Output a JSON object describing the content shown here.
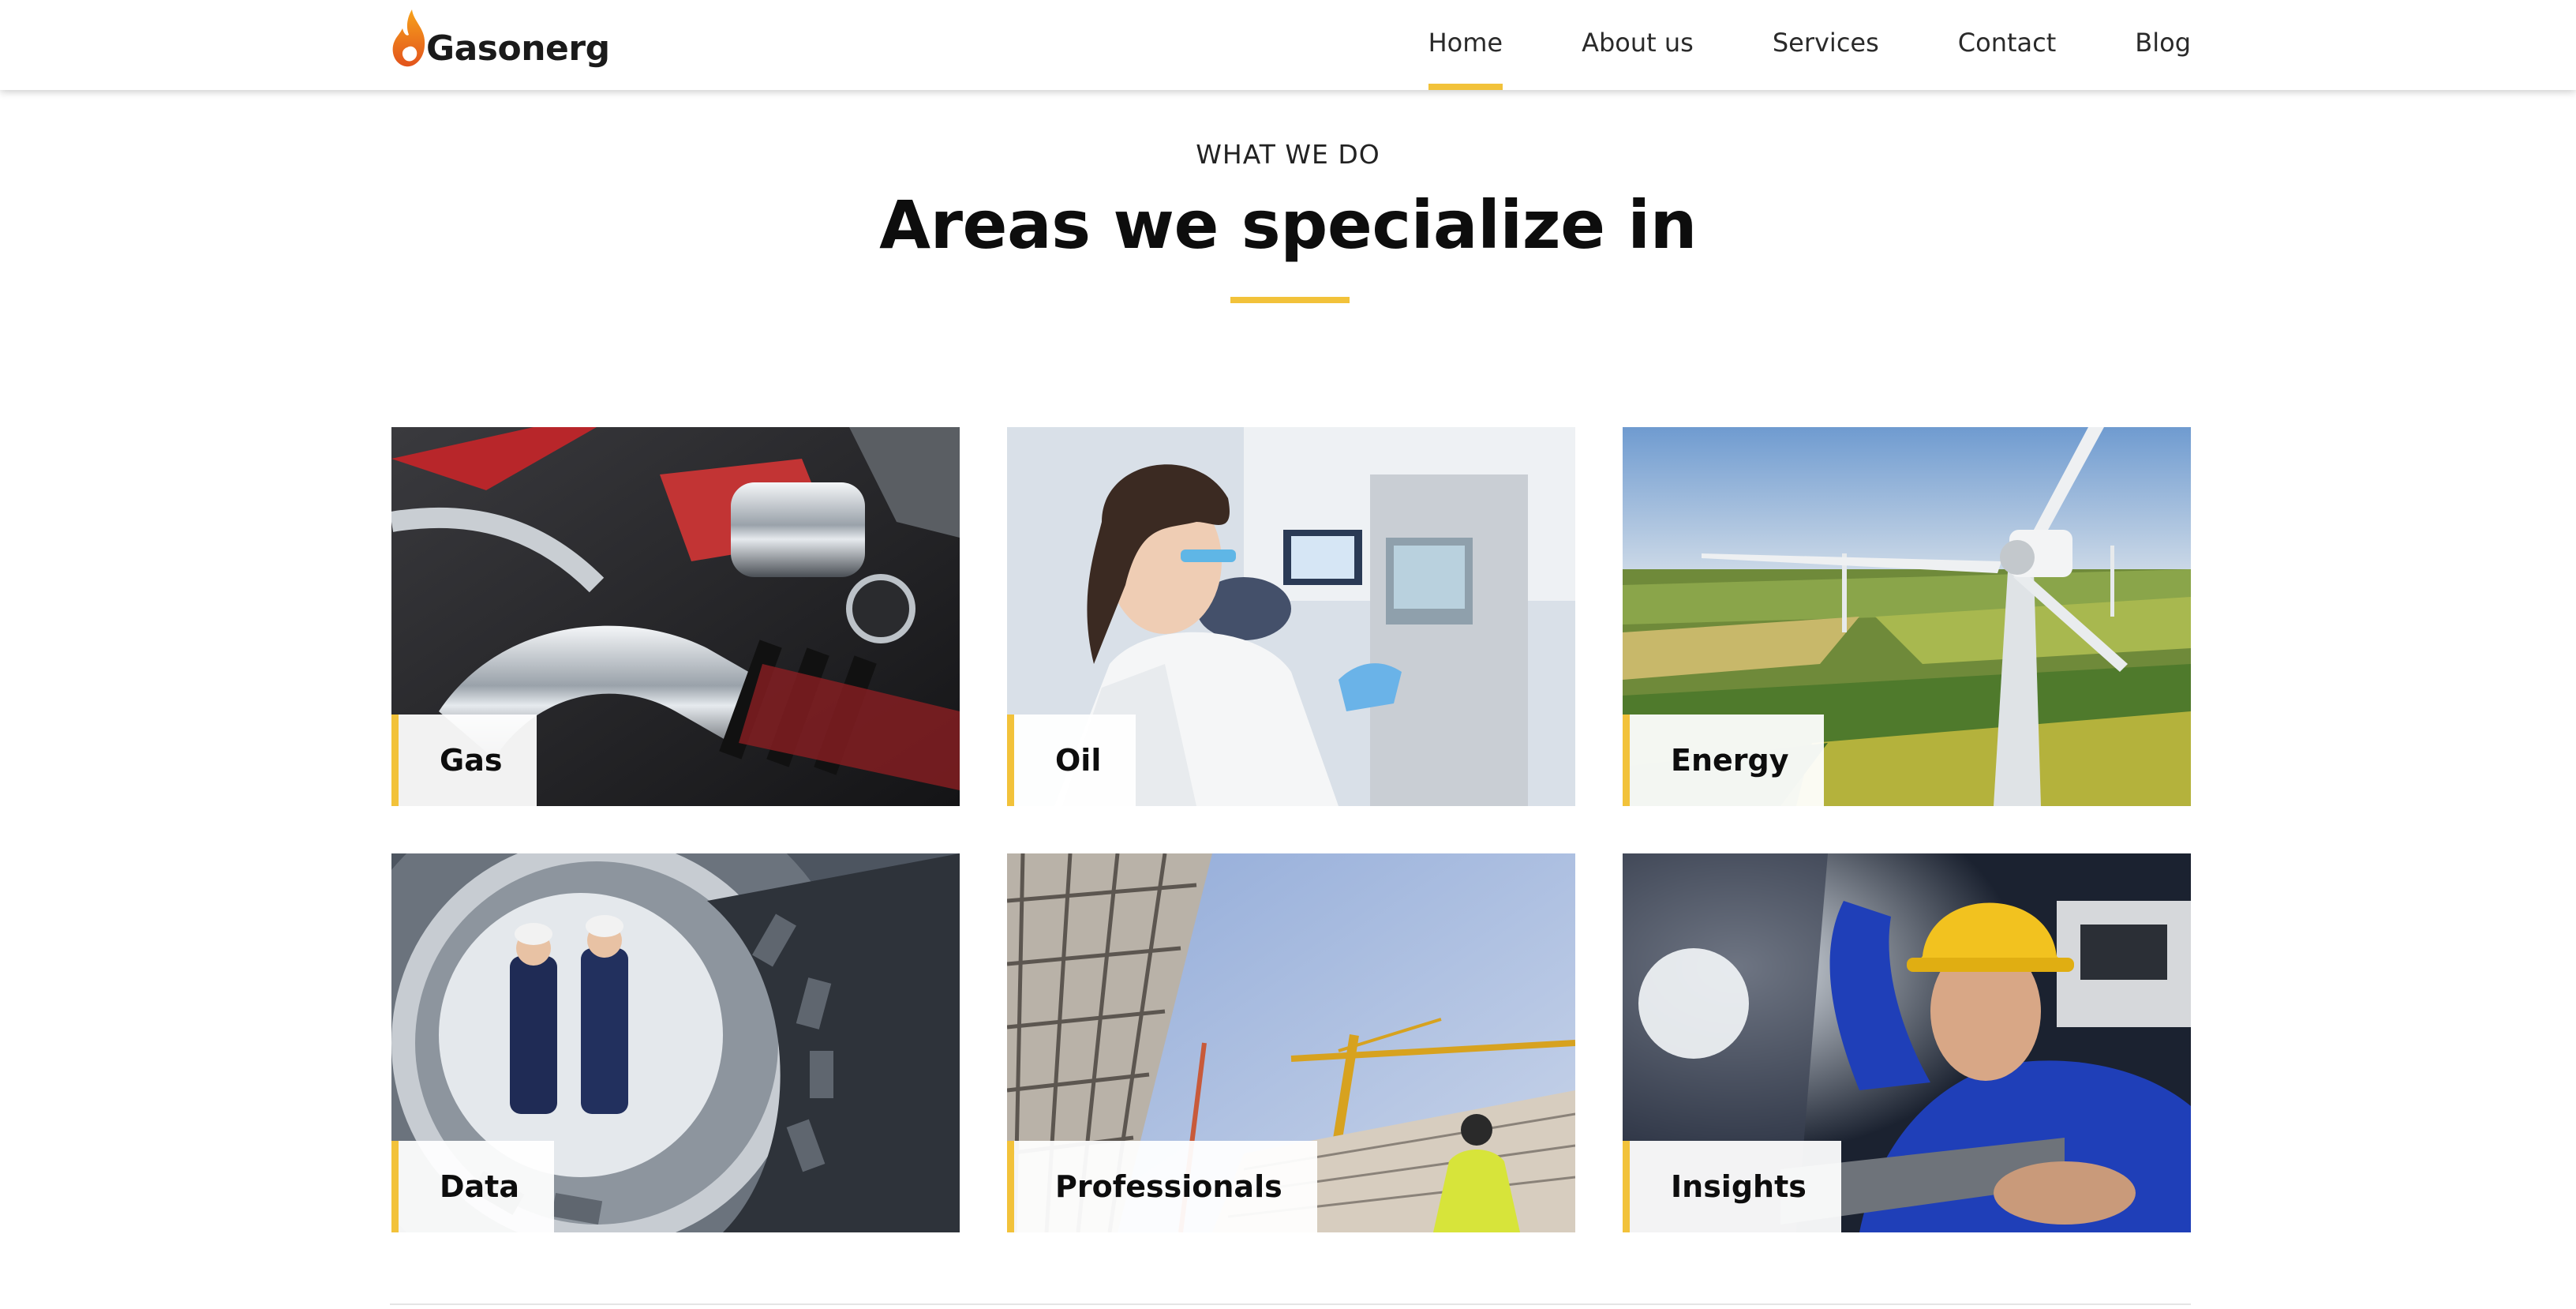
{
  "brand": {
    "name": "Gasonerg",
    "accent": "#f2c23a"
  },
  "nav": {
    "items": [
      {
        "label": "Home",
        "active": true
      },
      {
        "label": "About us",
        "active": false
      },
      {
        "label": "Services",
        "active": false
      },
      {
        "label": "Contact",
        "active": false
      },
      {
        "label": "Blog",
        "active": false
      }
    ]
  },
  "section": {
    "eyebrow": "WHAT WE DO",
    "title": "Areas we specialize in"
  },
  "cards": [
    {
      "label": "Gas",
      "image": "engine-pipes"
    },
    {
      "label": "Oil",
      "image": "lab-scientist"
    },
    {
      "label": "Energy",
      "image": "wind-turbine"
    },
    {
      "label": "Data",
      "image": "gear-workers"
    },
    {
      "label": "Professionals",
      "image": "construction-cranes"
    },
    {
      "label": "Insights",
      "image": "hardhat-worker"
    }
  ]
}
